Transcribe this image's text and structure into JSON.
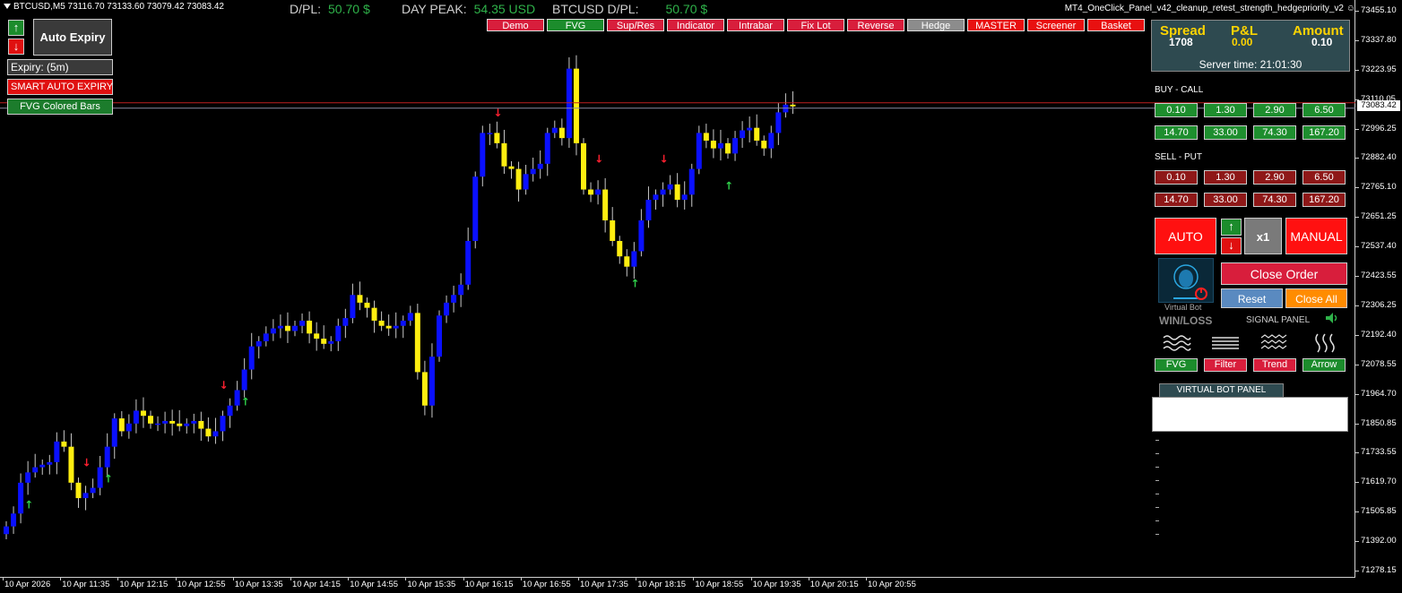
{
  "window": {
    "symbol_info": "BTCUSD,M5  73116.70 73133.60 73079.42 73083.42",
    "ea_title": "MT4_OneClick_Panel_v42_cleanup_retest_strength_hedgepriority_v2"
  },
  "header": {
    "dpl_label": "D/PL:",
    "dpl_value": "50.70 $",
    "peak_label": "DAY PEAK:",
    "peak_value": "54.35 USD",
    "sym_label": "BTCUSD D/PL:",
    "sym_value": "50.70 $"
  },
  "top_buttons": [
    {
      "label": "Demo",
      "color": "#d81e3c",
      "w": 64
    },
    {
      "label": "FVG",
      "color": "#1c8c2c",
      "w": 64
    },
    {
      "label": "Sup/Res",
      "color": "#d81e3c",
      "w": 64
    },
    {
      "label": "Indicator",
      "color": "#d81e3c",
      "w": 64
    },
    {
      "label": "Intrabar",
      "color": "#d81e3c",
      "w": 64
    },
    {
      "label": "Fix Lot",
      "color": "#d81e3c",
      "w": 64
    },
    {
      "label": "Reverse",
      "color": "#d81e3c",
      "w": 64
    },
    {
      "label": "Hedge",
      "color": "#8c8c8c",
      "w": 64
    },
    {
      "label": "MASTER",
      "color": "#e81010",
      "w": 64
    },
    {
      "label": "Screener",
      "color": "#e81010",
      "w": 64
    },
    {
      "label": "Basket",
      "color": "#e81010",
      "w": 64
    }
  ],
  "left_panel": {
    "up_arrow": "↑",
    "down_arrow": "↓",
    "auto_expiry": "Auto Expiry",
    "expiry": "Expiry: (5m)",
    "smart_auto_expiry": "SMART AUTO EXPIRY",
    "fvg_bars": "FVG Colored Bars"
  },
  "panel": {
    "spread_label": "Spread",
    "spread_value": "1708",
    "pl_label": "P&L",
    "pl_value": "0.00",
    "amount_label": "Amount",
    "amount_value": "0.10",
    "server_time": "Server time: 21:01:30",
    "buy_label": "BUY - CALL",
    "sell_label": "SELL - PUT",
    "amounts": [
      "0.10",
      "1.30",
      "2.90",
      "6.50",
      "14.70",
      "33.00",
      "74.30",
      "167.20"
    ],
    "auto": "AUTO",
    "x1": "x1",
    "manual": "MANUAL",
    "close_order": "Close Order",
    "reset": "Reset",
    "close_all": "Close All",
    "virtual_bot": "Virtual Bot",
    "win_loss": "WIN/LOSS",
    "signal_panel": "SIGNAL PANEL",
    "signal_buttons": [
      {
        "label": "FVG",
        "color": "#1c8c2c"
      },
      {
        "label": "Filter",
        "color": "#d81e3c"
      },
      {
        "label": "Trend",
        "color": "#d81e3c"
      },
      {
        "label": "Arrow",
        "color": "#1c8c2c"
      }
    ],
    "virtual_bot_panel": "VIRTUAL BOT PANEL",
    "colors": {
      "accent_red": "#ff1010",
      "orange": "#ff8c00",
      "steel": "#5a8ac0",
      "crimson": "#d81e3c"
    }
  },
  "chart_data": {
    "type": "candlestick",
    "y_ticks": [
      "73455.10",
      "73337.80",
      "73223.95",
      "73110.05",
      "72996.25",
      "72882.40",
      "72765.10",
      "72651.25",
      "72537.40",
      "72423.55",
      "72306.25",
      "72192.40",
      "72078.55",
      "71964.70",
      "71850.85",
      "71733.55",
      "71619.70",
      "71505.85",
      "71392.00",
      "71278.15"
    ],
    "x_ticks": [
      "10 Apr 2026",
      "10 Apr 11:35",
      "10 Apr 12:15",
      "10 Apr 12:55",
      "10 Apr 13:35",
      "10 Apr 14:15",
      "10 Apr 14:55",
      "10 Apr 15:35",
      "10 Apr 16:15",
      "10 Apr 16:55",
      "10 Apr 17:35",
      "10 Apr 18:15",
      "10 Apr 18:55",
      "10 Apr 19:35",
      "10 Apr 20:15",
      "10 Apr 20:55"
    ],
    "current_price": "73083.42",
    "closes": [
      71450,
      71500,
      71620,
      71660,
      71680,
      71690,
      71700,
      71780,
      71760,
      71620,
      71560,
      71580,
      71600,
      71680,
      71760,
      71870,
      71820,
      71850,
      71900,
      71880,
      71850,
      71850,
      71860,
      71850,
      71840,
      71850,
      71860,
      71830,
      71800,
      71820,
      71880,
      71920,
      71980,
      72060,
      72150,
      72170,
      72200,
      72220,
      72230,
      72210,
      72230,
      72250,
      72200,
      72180,
      72160,
      72170,
      72230,
      72260,
      72350,
      72320,
      72300,
      72250,
      72230,
      72220,
      72230,
      72250,
      72280,
      72050,
      71920,
      72110,
      72270,
      72320,
      72350,
      72390,
      72560,
      72810,
      72980,
      72980,
      72940,
      72850,
      72840,
      72760,
      72820,
      72840,
      72860,
      72980,
      73000,
      72960,
      73230,
      72940,
      72760,
      72740,
      72760,
      72640,
      72560,
      72500,
      72460,
      72520,
      72640,
      72720,
      72740,
      72760,
      72780,
      72720,
      72740,
      72840,
      72980,
      72950,
      72920,
      72940,
      72900,
      72960,
      72990,
      73000,
      72950,
      72920,
      72980,
      73060,
      73090,
      73083
    ],
    "arrows_up_at": [
      3,
      14,
      33,
      87,
      100
    ],
    "arrows_down_at": [
      11,
      30,
      68,
      82,
      91
    ]
  }
}
